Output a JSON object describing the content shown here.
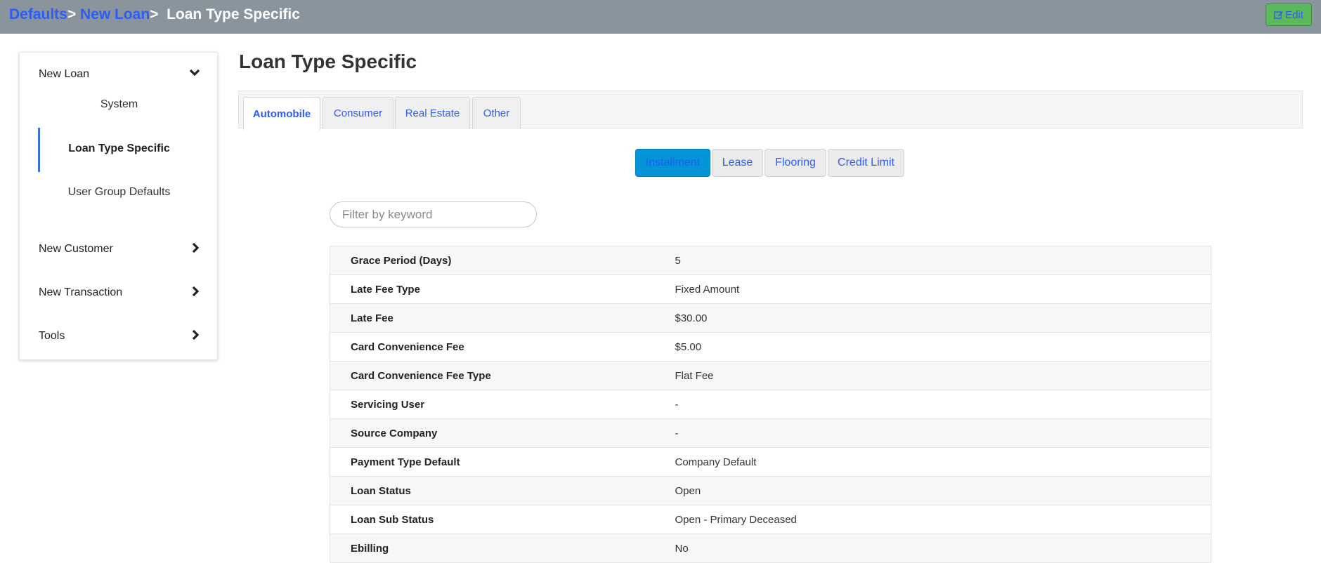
{
  "breadcrumb": {
    "items": [
      {
        "label": "Defaults"
      },
      {
        "label": "New Loan"
      },
      {
        "label": "Loan Type Specific"
      }
    ],
    "separator": ">"
  },
  "header": {
    "edit_label": "Edit",
    "edit_icon": "edit-icon",
    "bar_color": "#8a949c",
    "edit_color": "#5cb85c"
  },
  "sidebar": {
    "groups": [
      {
        "label": "New Loan",
        "icon": "chevron-down-icon",
        "expanded": true,
        "items": [
          {
            "label": "System"
          },
          {
            "label": "Loan Type Specific",
            "active": true
          },
          {
            "label": "User Group Defaults"
          }
        ]
      },
      {
        "label": "New Customer",
        "icon": "chevron-right-icon"
      },
      {
        "label": "New Transaction",
        "icon": "chevron-right-icon"
      },
      {
        "label": "Tools",
        "icon": "chevron-right-icon"
      }
    ]
  },
  "main": {
    "title": "Loan Type Specific",
    "tabs": [
      {
        "label": "Automobile",
        "active": true
      },
      {
        "label": "Consumer"
      },
      {
        "label": "Real Estate"
      },
      {
        "label": "Other"
      }
    ],
    "subtabs": [
      {
        "label": "Installment",
        "active": true
      },
      {
        "label": "Lease"
      },
      {
        "label": "Flooring"
      },
      {
        "label": "Credit Limit"
      }
    ],
    "filter": {
      "placeholder": "Filter by keyword",
      "value": ""
    },
    "rows": [
      {
        "label": "Grace Period (Days)",
        "value": "5"
      },
      {
        "label": "Late Fee Type",
        "value": "Fixed Amount"
      },
      {
        "label": "Late Fee",
        "value": "$30.00"
      },
      {
        "label": "Card Convenience Fee",
        "value": "$5.00"
      },
      {
        "label": "Card Convenience Fee Type",
        "value": "Flat Fee"
      },
      {
        "label": "Servicing User",
        "value": "-"
      },
      {
        "label": "Source Company",
        "value": "-"
      },
      {
        "label": "Payment Type Default",
        "value": "Company Default"
      },
      {
        "label": "Loan Status",
        "value": "Open"
      },
      {
        "label": "Loan Sub Status",
        "value": "Open - Primary Deceased"
      },
      {
        "label": "Ebilling",
        "value": "No"
      }
    ],
    "active_subtab_color": "#0594d8",
    "link_color": "#2d5cf6"
  }
}
